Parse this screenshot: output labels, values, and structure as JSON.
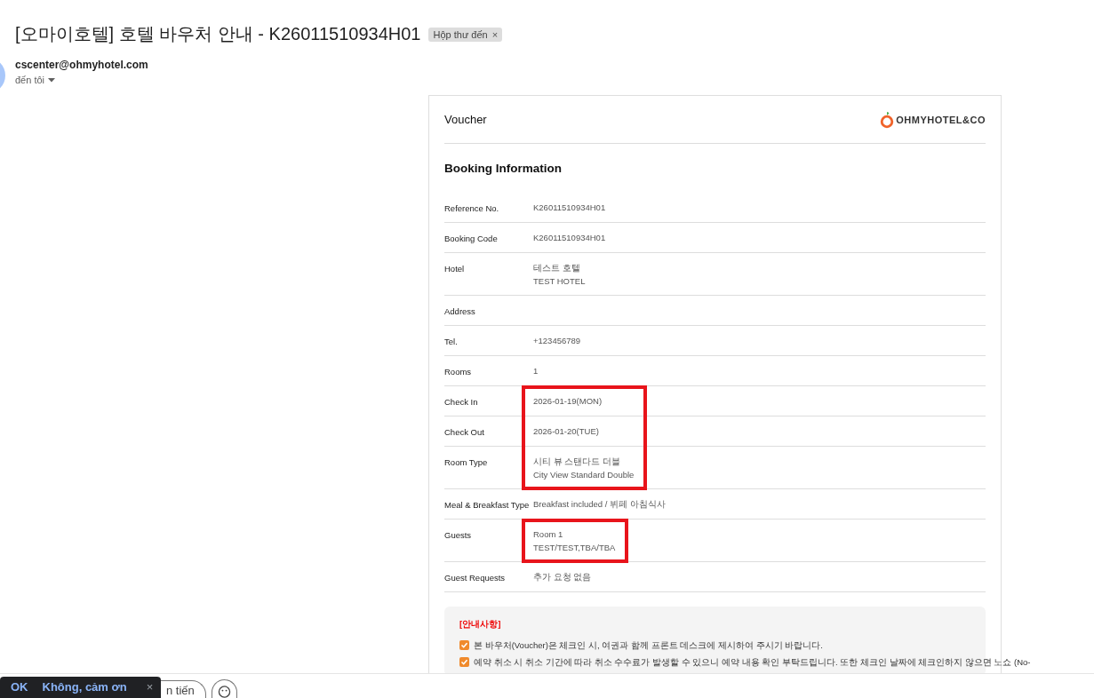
{
  "email": {
    "subject": "[오마이호텔] 호텔 바우처 안내 - K26011510934H01",
    "label_chip": {
      "text": "Hộp thư đến",
      "close": "×"
    },
    "sender": "cscenter@ohmyhotel.com",
    "recipient": "đến tôi"
  },
  "voucher": {
    "title": "Voucher",
    "logo": "OHMYHOTEL&CO",
    "section": "Booking Information",
    "rows": [
      {
        "label": "Reference No.",
        "lines": [
          "K26011510934H01"
        ],
        "highlighted": false
      },
      {
        "label": "Booking Code",
        "lines": [
          "K26011510934H01"
        ],
        "highlighted": false
      },
      {
        "label": "Hotel",
        "lines": [
          "테스트 호텔",
          "TEST HOTEL"
        ],
        "highlighted": false
      },
      {
        "label": "Address",
        "lines": [],
        "highlighted": false
      },
      {
        "label": "Tel.",
        "lines": [
          "+123456789"
        ],
        "highlighted": false
      },
      {
        "label": "Rooms",
        "lines": [
          "1"
        ],
        "highlighted": false
      },
      {
        "label": "Check In",
        "lines": [
          "2026-01-19(MON)"
        ],
        "highlighted": true
      },
      {
        "label": "Check Out",
        "lines": [
          "2026-01-20(TUE)"
        ],
        "highlighted": true
      },
      {
        "label": "Room Type",
        "lines": [
          "시티 뷰 스탠다드 더블",
          "City View Standard Double"
        ],
        "highlighted": true
      },
      {
        "label": "Meal & Breakfast Type",
        "lines": [
          "Breakfast included / 뷔페 아침식사"
        ],
        "highlighted": false
      },
      {
        "label": "Guests",
        "lines": [
          "Room 1",
          "TEST/TEST,TBA/TBA"
        ],
        "highlighted": true
      },
      {
        "label": "Guest Requests",
        "lines": [
          "추가 요청 없음"
        ],
        "highlighted": false
      }
    ],
    "notice": {
      "title": "[안내사항]",
      "items": [
        {
          "lines": [
            "본 바우처(Voucher)은 체크인 시, 여권과 함께 프론트 데스크에 제시하여 주시기 바랍니다."
          ],
          "checked": true
        },
        {
          "lines": [
            "예약 취소 시 취소 기간에 따라 취소 수수료가 발생할 수 있으니 예약 내용 확인 부탁드립니다. 또한 체크인 날짜에 체크인하지 않으면 노쇼 (No-"
          ],
          "checked": true
        }
      ]
    }
  },
  "reply_bar": {
    "forward_button": "n tiến"
  },
  "snackbar": {
    "ok": "OK",
    "dismiss": "Không, cảm ơn",
    "close": "×"
  }
}
